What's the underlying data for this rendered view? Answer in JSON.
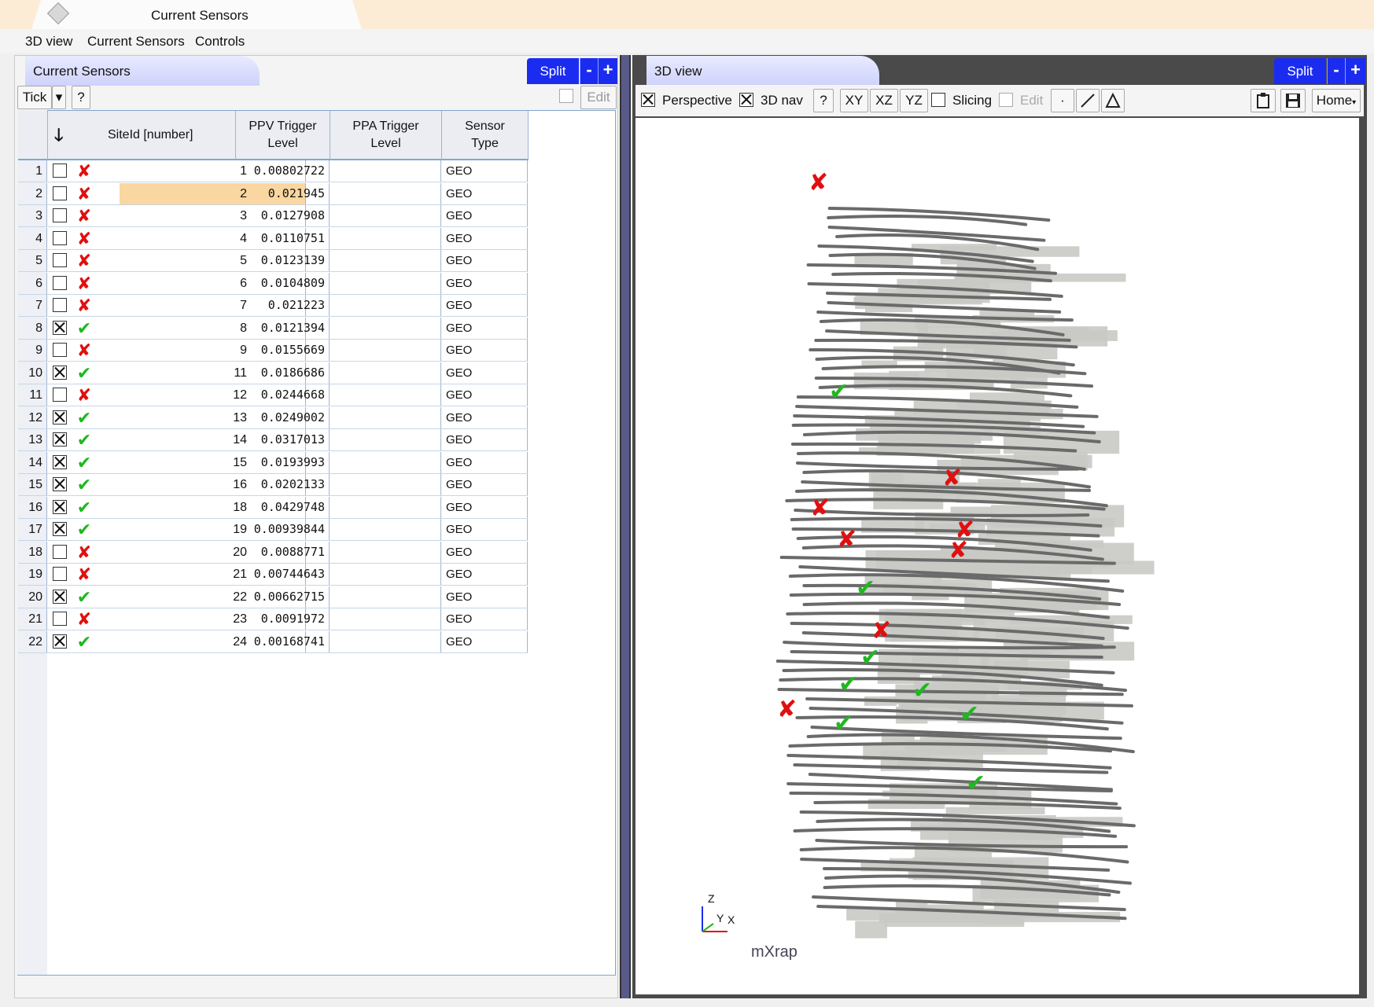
{
  "window": {
    "doc_tab_title": "Current Sensors"
  },
  "menubar": {
    "items": [
      "3D view",
      "Current Sensors",
      "Controls"
    ]
  },
  "sensors_panel": {
    "tab_title": "Current Sensors",
    "split_label": "Split",
    "minus_label": "-",
    "plus_label": "+",
    "toolbar": {
      "tick_label": "Tick",
      "help_label": "?",
      "edit_label": "Edit"
    },
    "columns": {
      "site": "SiteId [number]",
      "ppv": "PPV Trigger Level",
      "ppa": "PPA Trigger Level",
      "type": "Sensor Type"
    },
    "rows": [
      {
        "n": "1",
        "checked": false,
        "status": "fail",
        "site": "1",
        "ppv": "0.00802722",
        "ppa": "",
        "type": "GEO"
      },
      {
        "n": "2",
        "checked": false,
        "status": "fail",
        "site": "2",
        "ppv": "0.021945",
        "ppa": "",
        "type": "GEO",
        "selected": true
      },
      {
        "n": "3",
        "checked": false,
        "status": "fail",
        "site": "3",
        "ppv": "0.0127908",
        "ppa": "",
        "type": "GEO"
      },
      {
        "n": "4",
        "checked": false,
        "status": "fail",
        "site": "4",
        "ppv": "0.0110751",
        "ppa": "",
        "type": "GEO"
      },
      {
        "n": "5",
        "checked": false,
        "status": "fail",
        "site": "5",
        "ppv": "0.0123139",
        "ppa": "",
        "type": "GEO"
      },
      {
        "n": "6",
        "checked": false,
        "status": "fail",
        "site": "6",
        "ppv": "0.0104809",
        "ppa": "",
        "type": "GEO"
      },
      {
        "n": "7",
        "checked": false,
        "status": "fail",
        "site": "7",
        "ppv": "0.021223",
        "ppa": "",
        "type": "GEO"
      },
      {
        "n": "8",
        "checked": true,
        "status": "ok",
        "site": "8",
        "ppv": "0.0121394",
        "ppa": "",
        "type": "GEO"
      },
      {
        "n": "9",
        "checked": false,
        "status": "fail",
        "site": "9",
        "ppv": "0.0155669",
        "ppa": "",
        "type": "GEO"
      },
      {
        "n": "10",
        "checked": true,
        "status": "ok",
        "site": "11",
        "ppv": "0.0186686",
        "ppa": "",
        "type": "GEO"
      },
      {
        "n": "11",
        "checked": false,
        "status": "fail",
        "site": "12",
        "ppv": "0.0244668",
        "ppa": "",
        "type": "GEO"
      },
      {
        "n": "12",
        "checked": true,
        "status": "ok",
        "site": "13",
        "ppv": "0.0249002",
        "ppa": "",
        "type": "GEO"
      },
      {
        "n": "13",
        "checked": true,
        "status": "ok",
        "site": "14",
        "ppv": "0.0317013",
        "ppa": "",
        "type": "GEO"
      },
      {
        "n": "14",
        "checked": true,
        "status": "ok",
        "site": "15",
        "ppv": "0.0193993",
        "ppa": "",
        "type": "GEO"
      },
      {
        "n": "15",
        "checked": true,
        "status": "ok",
        "site": "16",
        "ppv": "0.0202133",
        "ppa": "",
        "type": "GEO"
      },
      {
        "n": "16",
        "checked": true,
        "status": "ok",
        "site": "18",
        "ppv": "0.0429748",
        "ppa": "",
        "type": "GEO"
      },
      {
        "n": "17",
        "checked": true,
        "status": "ok",
        "site": "19",
        "ppv": "0.00939844",
        "ppa": "",
        "type": "GEO"
      },
      {
        "n": "18",
        "checked": false,
        "status": "fail",
        "site": "20",
        "ppv": "0.0088771",
        "ppa": "",
        "type": "GEO"
      },
      {
        "n": "19",
        "checked": false,
        "status": "fail",
        "site": "21",
        "ppv": "0.00744643",
        "ppa": "",
        "type": "GEO"
      },
      {
        "n": "20",
        "checked": true,
        "status": "ok",
        "site": "22",
        "ppv": "0.00662715",
        "ppa": "",
        "type": "GEO"
      },
      {
        "n": "21",
        "checked": false,
        "status": "fail",
        "site": "23",
        "ppv": "0.0091972",
        "ppa": "",
        "type": "GEO"
      },
      {
        "n": "22",
        "checked": true,
        "status": "ok",
        "site": "24",
        "ppv": "0.00168741",
        "ppa": "",
        "type": "GEO"
      }
    ]
  },
  "view_panel": {
    "tab_title": "3D view",
    "split_label": "Split",
    "minus_label": "-",
    "plus_label": "+",
    "toolbar": {
      "perspective_label": "Perspective",
      "perspective_checked": true,
      "nav3d_label": "3D nav",
      "nav3d_checked": true,
      "help_label": "?",
      "xy_label": "XY",
      "xz_label": "XZ",
      "yz_label": "YZ",
      "slicing_label": "Slicing",
      "slicing_checked": false,
      "edit_label": "Edit",
      "home_label": "Home"
    },
    "axes": {
      "z": "Z",
      "y": "Y",
      "x": "X"
    },
    "logo": "mXrap"
  },
  "colors": {
    "accent": "#1b2cf0",
    "ok": "#1fb81f",
    "fail": "#e01010",
    "selected_row": "#fad7a0",
    "tunnel": "#6a6a6a",
    "orebody": "#c9c9c4"
  }
}
